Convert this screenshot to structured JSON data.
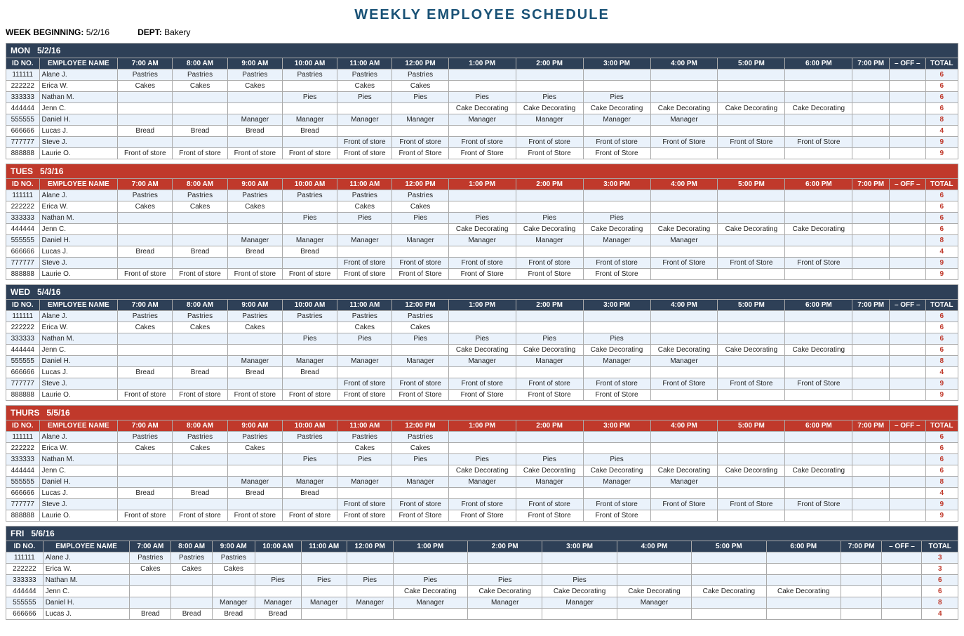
{
  "title": "WEEKLY EMPLOYEE SCHEDULE",
  "meta": {
    "week_label": "WEEK BEGINNING:",
    "week_value": "5/2/16",
    "dept_label": "DEPT:",
    "dept_value": "Bakery"
  },
  "time_cols": [
    "7:00 AM",
    "8:00 AM",
    "9:00 AM",
    "10:00 AM",
    "11:00 AM",
    "12:00 PM",
    "1:00 PM",
    "2:00 PM",
    "3:00 PM",
    "4:00 PM",
    "5:00 PM",
    "6:00 PM",
    "7:00 PM"
  ],
  "days": [
    {
      "name": "MON",
      "date": "5/2/16",
      "color_class": "mon",
      "employees": [
        {
          "id": "111111",
          "name": "Alane J.",
          "slots": [
            "Pastries",
            "Pastries",
            "Pastries",
            "Pastries",
            "Pastries",
            "Pastries",
            "",
            "",
            "",
            "",
            "",
            "",
            ""
          ],
          "total": 6
        },
        {
          "id": "222222",
          "name": "Erica W.",
          "slots": [
            "Cakes",
            "Cakes",
            "Cakes",
            "",
            "Cakes",
            "Cakes",
            "",
            "",
            "",
            "",
            "",
            "",
            ""
          ],
          "total": 6
        },
        {
          "id": "333333",
          "name": "Nathan M.",
          "slots": [
            "",
            "",
            "",
            "Pies",
            "Pies",
            "Pies",
            "Pies",
            "Pies",
            "Pies",
            "",
            "",
            "",
            ""
          ],
          "total": 6
        },
        {
          "id": "444444",
          "name": "Jenn C.",
          "slots": [
            "",
            "",
            "",
            "",
            "",
            "",
            "Cake Decorating",
            "Cake Decorating",
            "Cake Decorating",
            "Cake Decorating",
            "Cake Decorating",
            "Cake Decorating",
            ""
          ],
          "total": 6
        },
        {
          "id": "555555",
          "name": "Daniel H.",
          "slots": [
            "",
            "",
            "Manager",
            "Manager",
            "Manager",
            "Manager",
            "Manager",
            "Manager",
            "Manager",
            "Manager",
            "",
            "",
            ""
          ],
          "total": 8
        },
        {
          "id": "666666",
          "name": "Lucas J.",
          "slots": [
            "Bread",
            "Bread",
            "Bread",
            "Bread",
            "",
            "",
            "",
            "",
            "",
            "",
            "",
            "",
            ""
          ],
          "total": 4
        },
        {
          "id": "777777",
          "name": "Steve J.",
          "slots": [
            "",
            "",
            "",
            "",
            "Front of store",
            "Front of store",
            "Front of store",
            "Front of store",
            "Front of store",
            "Front of Store",
            "Front of Store",
            "Front of Store",
            ""
          ],
          "total": 9
        },
        {
          "id": "888888",
          "name": "Laurie O.",
          "slots": [
            "Front of store",
            "Front of store",
            "Front of store",
            "Front of store",
            "Front of store",
            "Front of Store",
            "Front of Store",
            "Front of Store",
            "Front of Store",
            "",
            "",
            "",
            ""
          ],
          "total": 9
        }
      ]
    },
    {
      "name": "TUES",
      "date": "5/3/16",
      "color_class": "tues",
      "employees": [
        {
          "id": "111111",
          "name": "Alane J.",
          "slots": [
            "Pastries",
            "Pastries",
            "Pastries",
            "Pastries",
            "Pastries",
            "Pastries",
            "",
            "",
            "",
            "",
            "",
            "",
            ""
          ],
          "total": 6
        },
        {
          "id": "222222",
          "name": "Erica W.",
          "slots": [
            "Cakes",
            "Cakes",
            "Cakes",
            "",
            "Cakes",
            "Cakes",
            "",
            "",
            "",
            "",
            "",
            "",
            ""
          ],
          "total": 6
        },
        {
          "id": "333333",
          "name": "Nathan M.",
          "slots": [
            "",
            "",
            "",
            "Pies",
            "Pies",
            "Pies",
            "Pies",
            "Pies",
            "Pies",
            "",
            "",
            "",
            ""
          ],
          "total": 6
        },
        {
          "id": "444444",
          "name": "Jenn C.",
          "slots": [
            "",
            "",
            "",
            "",
            "",
            "",
            "Cake Decorating",
            "Cake Decorating",
            "Cake Decorating",
            "Cake Decorating",
            "Cake Decorating",
            "Cake Decorating",
            ""
          ],
          "total": 6
        },
        {
          "id": "555555",
          "name": "Daniel H.",
          "slots": [
            "",
            "",
            "Manager",
            "Manager",
            "Manager",
            "Manager",
            "Manager",
            "Manager",
            "Manager",
            "Manager",
            "",
            "",
            ""
          ],
          "total": 8
        },
        {
          "id": "666666",
          "name": "Lucas J.",
          "slots": [
            "Bread",
            "Bread",
            "Bread",
            "Bread",
            "",
            "",
            "",
            "",
            "",
            "",
            "",
            "",
            ""
          ],
          "total": 4
        },
        {
          "id": "777777",
          "name": "Steve J.",
          "slots": [
            "",
            "",
            "",
            "",
            "Front of store",
            "Front of store",
            "Front of store",
            "Front of store",
            "Front of store",
            "Front of Store",
            "Front of Store",
            "Front of Store",
            ""
          ],
          "total": 9
        },
        {
          "id": "888888",
          "name": "Laurie O.",
          "slots": [
            "Front of store",
            "Front of store",
            "Front of store",
            "Front of store",
            "Front of store",
            "Front of Store",
            "Front of Store",
            "Front of Store",
            "Front of Store",
            "",
            "",
            "",
            ""
          ],
          "total": 9
        }
      ]
    },
    {
      "name": "WED",
      "date": "5/4/16",
      "color_class": "wed",
      "employees": [
        {
          "id": "111111",
          "name": "Alane J.",
          "slots": [
            "Pastries",
            "Pastries",
            "Pastries",
            "Pastries",
            "Pastries",
            "Pastries",
            "",
            "",
            "",
            "",
            "",
            "",
            ""
          ],
          "total": 6
        },
        {
          "id": "222222",
          "name": "Erica W.",
          "slots": [
            "Cakes",
            "Cakes",
            "Cakes",
            "",
            "Cakes",
            "Cakes",
            "",
            "",
            "",
            "",
            "",
            "",
            ""
          ],
          "total": 6
        },
        {
          "id": "333333",
          "name": "Nathan M.",
          "slots": [
            "",
            "",
            "",
            "Pies",
            "Pies",
            "Pies",
            "Pies",
            "Pies",
            "Pies",
            "",
            "",
            "",
            ""
          ],
          "total": 6
        },
        {
          "id": "444444",
          "name": "Jenn C.",
          "slots": [
            "",
            "",
            "",
            "",
            "",
            "",
            "Cake Decorating",
            "Cake Decorating",
            "Cake Decorating",
            "Cake Decorating",
            "Cake Decorating",
            "Cake Decorating",
            ""
          ],
          "total": 6
        },
        {
          "id": "555555",
          "name": "Daniel H.",
          "slots": [
            "",
            "",
            "Manager",
            "Manager",
            "Manager",
            "Manager",
            "Manager",
            "Manager",
            "Manager",
            "Manager",
            "",
            "",
            ""
          ],
          "total": 8
        },
        {
          "id": "666666",
          "name": "Lucas J.",
          "slots": [
            "Bread",
            "Bread",
            "Bread",
            "Bread",
            "",
            "",
            "",
            "",
            "",
            "",
            "",
            "",
            ""
          ],
          "total": 4
        },
        {
          "id": "777777",
          "name": "Steve J.",
          "slots": [
            "",
            "",
            "",
            "",
            "Front of store",
            "Front of store",
            "Front of store",
            "Front of store",
            "Front of store",
            "Front of Store",
            "Front of Store",
            "Front of Store",
            ""
          ],
          "total": 9
        },
        {
          "id": "888888",
          "name": "Laurie O.",
          "slots": [
            "Front of store",
            "Front of store",
            "Front of store",
            "Front of store",
            "Front of store",
            "Front of Store",
            "Front of Store",
            "Front of Store",
            "Front of Store",
            "",
            "",
            "",
            ""
          ],
          "total": 9
        }
      ]
    },
    {
      "name": "THURS",
      "date": "5/5/16",
      "color_class": "thurs",
      "employees": [
        {
          "id": "111111",
          "name": "Alane J.",
          "slots": [
            "Pastries",
            "Pastries",
            "Pastries",
            "Pastries",
            "Pastries",
            "Pastries",
            "",
            "",
            "",
            "",
            "",
            "",
            ""
          ],
          "total": 6
        },
        {
          "id": "222222",
          "name": "Erica W.",
          "slots": [
            "Cakes",
            "Cakes",
            "Cakes",
            "",
            "Cakes",
            "Cakes",
            "",
            "",
            "",
            "",
            "",
            "",
            ""
          ],
          "total": 6
        },
        {
          "id": "333333",
          "name": "Nathan M.",
          "slots": [
            "",
            "",
            "",
            "Pies",
            "Pies",
            "Pies",
            "Pies",
            "Pies",
            "Pies",
            "",
            "",
            "",
            ""
          ],
          "total": 6
        },
        {
          "id": "444444",
          "name": "Jenn C.",
          "slots": [
            "",
            "",
            "",
            "",
            "",
            "",
            "Cake Decorating",
            "Cake Decorating",
            "Cake Decorating",
            "Cake Decorating",
            "Cake Decorating",
            "Cake Decorating",
            ""
          ],
          "total": 6
        },
        {
          "id": "555555",
          "name": "Daniel H.",
          "slots": [
            "",
            "",
            "Manager",
            "Manager",
            "Manager",
            "Manager",
            "Manager",
            "Manager",
            "Manager",
            "Manager",
            "",
            "",
            ""
          ],
          "total": 8
        },
        {
          "id": "666666",
          "name": "Lucas J.",
          "slots": [
            "Bread",
            "Bread",
            "Bread",
            "Bread",
            "",
            "",
            "",
            "",
            "",
            "",
            "",
            "",
            ""
          ],
          "total": 4
        },
        {
          "id": "777777",
          "name": "Steve J.",
          "slots": [
            "",
            "",
            "",
            "",
            "Front of store",
            "Front of store",
            "Front of store",
            "Front of store",
            "Front of store",
            "Front of Store",
            "Front of Store",
            "Front of Store",
            ""
          ],
          "total": 9
        },
        {
          "id": "888888",
          "name": "Laurie O.",
          "slots": [
            "Front of store",
            "Front of store",
            "Front of store",
            "Front of store",
            "Front of store",
            "Front of Store",
            "Front of Store",
            "Front of Store",
            "Front of Store",
            "",
            "",
            "",
            ""
          ],
          "total": 9
        }
      ]
    },
    {
      "name": "FRI",
      "date": "5/6/16",
      "color_class": "fri",
      "employees": [
        {
          "id": "111111",
          "name": "Alane J.",
          "slots": [
            "Pastries",
            "Pastries",
            "Pastries",
            "",
            "",
            "",
            "",
            "",
            "",
            "",
            "",
            "",
            ""
          ],
          "total": 3
        },
        {
          "id": "222222",
          "name": "Erica W.",
          "slots": [
            "Cakes",
            "Cakes",
            "Cakes",
            "",
            "",
            "",
            "",
            "",
            "",
            "",
            "",
            "",
            ""
          ],
          "total": 3
        },
        {
          "id": "333333",
          "name": "Nathan M.",
          "slots": [
            "",
            "",
            "",
            "Pies",
            "Pies",
            "Pies",
            "Pies",
            "Pies",
            "Pies",
            "",
            "",
            "",
            ""
          ],
          "total": 6
        },
        {
          "id": "444444",
          "name": "Jenn C.",
          "slots": [
            "",
            "",
            "",
            "",
            "",
            "",
            "Cake Decorating",
            "Cake Decorating",
            "Cake Decorating",
            "Cake Decorating",
            "Cake Decorating",
            "Cake Decorating",
            ""
          ],
          "total": 6
        },
        {
          "id": "555555",
          "name": "Daniel H.",
          "slots": [
            "",
            "",
            "Manager",
            "Manager",
            "Manager",
            "Manager",
            "Manager",
            "Manager",
            "Manager",
            "Manager",
            "",
            "",
            ""
          ],
          "total": 8
        },
        {
          "id": "666666",
          "name": "Lucas J.",
          "slots": [
            "Bread",
            "Bread",
            "Bread",
            "Bread",
            "",
            "",
            "",
            "",
            "",
            "",
            "",
            "",
            ""
          ],
          "total": 4
        }
      ]
    }
  ],
  "col_headers": {
    "id_no": "ID NO.",
    "emp_name": "EMPLOYEE NAME",
    "off": "– OFF –",
    "total": "TOTAL"
  }
}
